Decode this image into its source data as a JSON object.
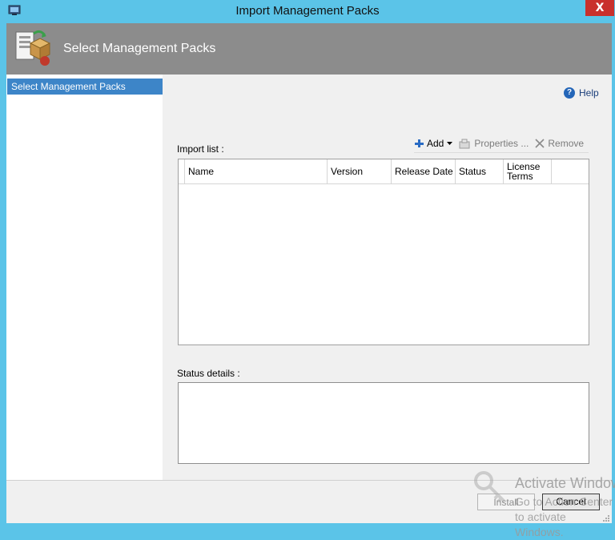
{
  "window": {
    "title": "Import Management Packs",
    "close_glyph": "X"
  },
  "header": {
    "title": "Select Management Packs",
    "icon": "management-pack-wizard-icon"
  },
  "nav": {
    "items": [
      {
        "label": "Select Management Packs",
        "selected": true
      }
    ]
  },
  "help": {
    "label": "Help",
    "icon": "help-icon"
  },
  "import_list": {
    "label": "Import list :",
    "columns": [
      "Name",
      "Version",
      "Release Date",
      "Status",
      "License Terms"
    ],
    "rows": []
  },
  "toolbar": {
    "add_label": "Add",
    "properties_label": "Properties ...",
    "remove_label": "Remove"
  },
  "status_details": {
    "label": "Status details :",
    "value": ""
  },
  "footer": {
    "install_label": "Install",
    "cancel_label": "Cancel"
  },
  "watermark": {
    "line1": "Activate Windows",
    "line2": "Go to Action Center to activate Windows."
  },
  "colors": {
    "titlebar": "#5bc4e8",
    "header_band": "#8c8c8c",
    "selection": "#3d85c8",
    "close_button": "#c9302c"
  }
}
